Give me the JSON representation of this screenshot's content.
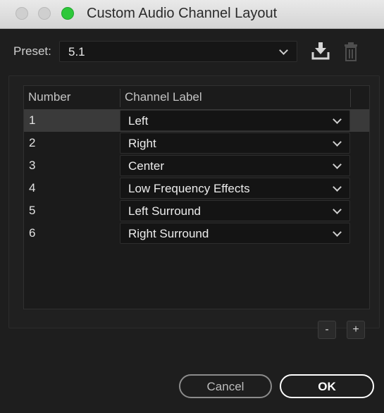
{
  "window": {
    "title": "Custom Audio Channel Layout"
  },
  "preset": {
    "label": "Preset:",
    "value": "5.1",
    "save_icon": "save-preset-icon",
    "delete_icon": "trash-icon"
  },
  "table": {
    "headers": {
      "number": "Number",
      "channel_label": "Channel Label"
    },
    "selected_row": 1,
    "rows": [
      {
        "number": "1",
        "label": "Left"
      },
      {
        "number": "2",
        "label": "Right"
      },
      {
        "number": "3",
        "label": "Center"
      },
      {
        "number": "4",
        "label": "Low Frequency Effects"
      },
      {
        "number": "5",
        "label": "Left Surround"
      },
      {
        "number": "6",
        "label": "Right Surround"
      }
    ]
  },
  "controls": {
    "remove_label": "-",
    "add_label": "+"
  },
  "buttons": {
    "cancel": "Cancel",
    "ok": "OK"
  },
  "colors": {
    "background": "#1e1e1e",
    "titlebar": "#dcdcdc",
    "zoom_light": "#2dc83a",
    "selected_row": "#3a3a3a"
  }
}
